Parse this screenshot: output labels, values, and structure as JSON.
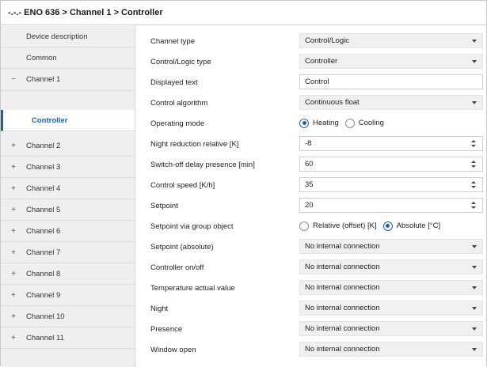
{
  "title": "-.-.- ENO 636 > Channel 1 > Controller",
  "sidebar": {
    "items": [
      {
        "label": "Device description",
        "marker": ""
      },
      {
        "label": "Common",
        "marker": ""
      },
      {
        "label": "Channel 1",
        "marker": "−"
      },
      {
        "label": "Controller",
        "marker": "",
        "active": true
      },
      {
        "label": "Channel 2",
        "marker": "+"
      },
      {
        "label": "Channel 3",
        "marker": "+"
      },
      {
        "label": "Channel 4",
        "marker": "+"
      },
      {
        "label": "Channel 5",
        "marker": "+"
      },
      {
        "label": "Channel 6",
        "marker": "+"
      },
      {
        "label": "Channel 7",
        "marker": "+"
      },
      {
        "label": "Channel 8",
        "marker": "+"
      },
      {
        "label": "Channel 9",
        "marker": "+"
      },
      {
        "label": "Channel 10",
        "marker": "+"
      },
      {
        "label": "Channel 11",
        "marker": "+"
      }
    ]
  },
  "params": {
    "channel_type": {
      "label": "Channel type",
      "value": "Control/Logic"
    },
    "control_logic_type": {
      "label": "Control/Logic type",
      "value": "Controller"
    },
    "displayed_text": {
      "label": "Displayed text",
      "value": "Control"
    },
    "control_algorithm": {
      "label": "Control algorithm",
      "value": "Continuous float"
    },
    "operating_mode": {
      "label": "Operating mode",
      "options": [
        "Heating",
        "Cooling"
      ],
      "selected": "Heating"
    },
    "night_reduction": {
      "label": "Night reduction relative [K]",
      "value": "-8"
    },
    "switch_off_delay": {
      "label": "Switch-off delay presence [min]",
      "value": "60"
    },
    "control_speed": {
      "label": "Control speed [K/h]",
      "value": "35"
    },
    "setpoint": {
      "label": "Setpoint",
      "value": "20"
    },
    "setpoint_group_object": {
      "label": "Setpoint via group object",
      "options": [
        "Relative (offset) [K]",
        "Absolute [°C]"
      ],
      "selected": "Absolute [°C]"
    },
    "setpoint_absolute": {
      "label": "Setpoint (absolute)",
      "value": "No internal connection"
    },
    "controller_on_off": {
      "label": "Controller on/off",
      "value": "No internal connection"
    },
    "temperature_actual": {
      "label": "Temperature actual value",
      "value": "No internal connection"
    },
    "night": {
      "label": "Night",
      "value": "No internal connection"
    },
    "presence": {
      "label": "Presence",
      "value": "No internal connection"
    },
    "window_open": {
      "label": "Window open",
      "value": "No internal connection"
    }
  },
  "colors": {
    "accent": "#1f5fa8",
    "sidebar_bg": "#efefef",
    "select_bg": "#f0f0f0"
  }
}
